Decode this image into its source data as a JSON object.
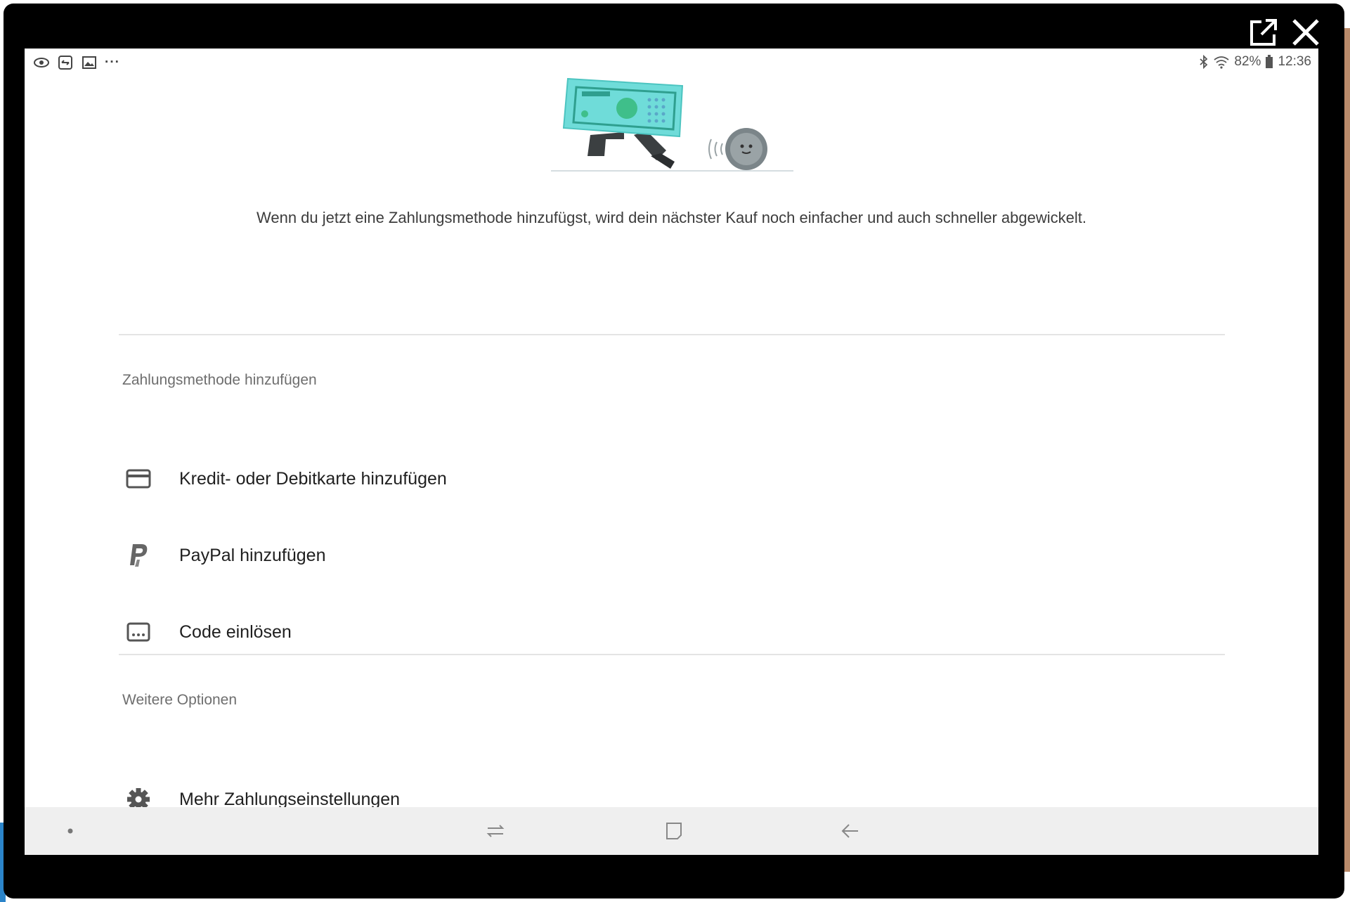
{
  "window": {
    "popout_icon": "popout-icon",
    "close_icon": "close-icon"
  },
  "statusbar": {
    "left_icons": [
      "eye-icon",
      "screen-icon",
      "image-icon",
      "more-dots-icon"
    ],
    "more_glyph": "···",
    "battery": "82%",
    "time": "12:36"
  },
  "intro": {
    "text": "Wenn du jetzt eine Zahlungsmethode hinzufügst, wird dein nächster Kauf noch einfacher und auch schneller abgewickelt."
  },
  "section_add": {
    "title": "Zahlungsmethode hinzufügen",
    "items": [
      {
        "label": "Kredit- oder Debitkarte hinzufügen",
        "icon": "credit-card-icon"
      },
      {
        "label": "PayPal hinzufügen",
        "icon": "paypal-icon"
      },
      {
        "label": "Code einlösen",
        "icon": "redeem-code-icon"
      }
    ]
  },
  "section_more": {
    "title": "Weitere Optionen",
    "items": [
      {
        "label": "Mehr Zahlungseinstellungen",
        "icon": "gear-icon"
      }
    ]
  },
  "colors": {
    "illustration_accent": "#6fdcd9",
    "illustration_green": "#3fbf8a",
    "text_primary": "#1f1f1f",
    "text_secondary": "#6e6e6e"
  }
}
